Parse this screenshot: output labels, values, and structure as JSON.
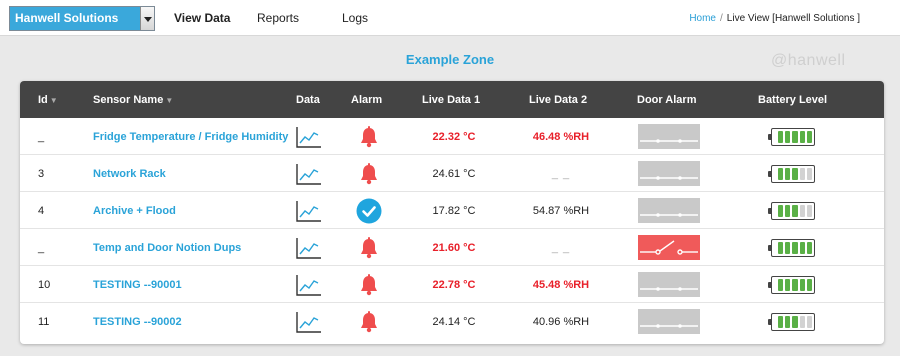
{
  "header": {
    "org_select_value": "Hanwell Solutions",
    "nav": [
      "View Data",
      "Reports",
      "Logs"
    ],
    "breadcrumb": {
      "home": "Home",
      "separator": "/",
      "current": "Live View [Hanwell Solutions ]"
    }
  },
  "zone_title": "Example Zone",
  "watermark": "@hanwell",
  "table": {
    "columns": {
      "id": "Id",
      "sensor_name": "Sensor Name",
      "data": "Data",
      "alarm": "Alarm",
      "live1": "Live Data 1",
      "live2": "Live Data 2",
      "door_alarm": "Door Alarm",
      "battery": "Battery Level"
    },
    "sort_icon": "▼",
    "colors": {
      "alarm_red": "#e8202a",
      "ok_blue": "#2aa3d8",
      "battery_green": "#5ab046",
      "door_alarm_red": "#f05a5a"
    },
    "rows": [
      {
        "id": "_",
        "name": "Fridge Temperature / Fridge Humidity",
        "alarm_icon": "bell-icon",
        "live1": "22.32 °C",
        "live1_alarm": true,
        "live2": "46.48 %RH",
        "live2_alarm": true,
        "door_alarm": false,
        "battery_bars": 5
      },
      {
        "id": "3",
        "name": "Network Rack",
        "alarm_icon": "bell-icon",
        "live1": "24.61 °C",
        "live1_alarm": false,
        "live2": "_ _",
        "live2_alarm": false,
        "door_alarm": false,
        "battery_bars": 3
      },
      {
        "id": "4",
        "name": "Archive + Flood",
        "alarm_icon": "check-icon",
        "live1": "17.82 °C",
        "live1_alarm": false,
        "live2": "54.87 %RH",
        "live2_alarm": false,
        "door_alarm": false,
        "battery_bars": 3
      },
      {
        "id": "_",
        "name": "Temp and Door Notion Dups",
        "alarm_icon": "bell-icon",
        "live1": "21.60 °C",
        "live1_alarm": true,
        "live2": "_ _",
        "live2_alarm": false,
        "door_alarm": true,
        "battery_bars": 5
      },
      {
        "id": "10",
        "name": "TESTING --90001",
        "alarm_icon": "bell-icon",
        "live1": "22.78 °C",
        "live1_alarm": true,
        "live2": "45.48 %RH",
        "live2_alarm": true,
        "door_alarm": false,
        "battery_bars": 5
      },
      {
        "id": "11",
        "name": "TESTING --90002",
        "alarm_icon": "bell-icon",
        "live1": "24.14 °C",
        "live1_alarm": false,
        "live2": "40.96 %RH",
        "live2_alarm": false,
        "door_alarm": false,
        "battery_bars": 3
      }
    ]
  }
}
